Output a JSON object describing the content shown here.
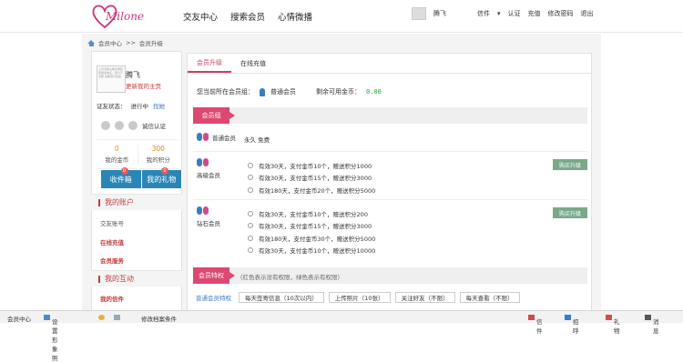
{
  "header": {
    "logo_text": "Milone",
    "nav": [
      "交友中心",
      "搜索会员",
      "心情微播"
    ],
    "user": {
      "name": "腾飞",
      "mail_label": "信件",
      "links": [
        "认证",
        "充值",
        "修改密码",
        "退出"
      ]
    }
  },
  "breadcrumb": {
    "home": "会员中心",
    "sep": ">>",
    "current": "会员升级"
  },
  "sidebar": {
    "profile_pic_text": "上传清晰头像才能获取更多信任，照片不清晰 会降低可信度",
    "nickname": "腾飞",
    "upload_link": "更新我的主页",
    "cert_label": "证友状态：",
    "cert_status": "进行中",
    "cert_link": "找她",
    "badge_text": "诚信认证",
    "stats": [
      {
        "num": "0",
        "label": "我的金币"
      },
      {
        "num": "300",
        "label": "我的积分"
      }
    ],
    "tab_buttons": [
      {
        "label": "收件箱",
        "count": "0"
      },
      {
        "label": "我的礼物",
        "count": "0"
      }
    ],
    "menu_account_head": "我的账户",
    "menu_account_items": [
      "交友账号",
      "在线充值",
      "会员服务"
    ],
    "menu_activity_head": "我的互动",
    "menu_activity_items": [
      "我的信件"
    ]
  },
  "main": {
    "tabs": [
      "会员升级",
      "在线充值"
    ],
    "current_level_label": "您当前所在会员组：",
    "current_level": "普通会员",
    "gold_label": "剩余可用金币：",
    "gold_value": "0.00",
    "section_group": "会员组",
    "levels": [
      {
        "name": "普通会员",
        "options": [
          "永久  免费"
        ],
        "buy": ""
      },
      {
        "name": "高级会员",
        "options": [
          "有效30天，支付金币10个，赠送积分1000",
          "有效30天，支付金币15个，赠送积分3000",
          "有效180天，支付金币20个，赠送积分5000"
        ],
        "buy": "购买升级"
      },
      {
        "name": "钻石会员",
        "options": [
          "有效30天，支付金币10个，赠送积分200",
          "有效30天，支付金币15个，赠送积分3000",
          "有效180天，支付金币30个，赠送积分5000",
          "有效30天，支付金币10个，赠送积分10000"
        ],
        "buy": "购买升级"
      }
    ],
    "section_priv": "会员特权",
    "priv_note": "（红色表示没有权限，绿色表示有权限）",
    "privileges_row_label": "普通会员特权",
    "privileges": [
      "每天签寄信息（10次以内）",
      "上传照片（10张）",
      "关注好友（不限）",
      "每天查看（不限）"
    ]
  },
  "bottombar": {
    "items": [
      "会员中心",
      "设置形象照",
      "",
      "修改档案条件"
    ],
    "right_items": [
      "信件",
      "招呼",
      "礼物",
      "消息"
    ]
  }
}
